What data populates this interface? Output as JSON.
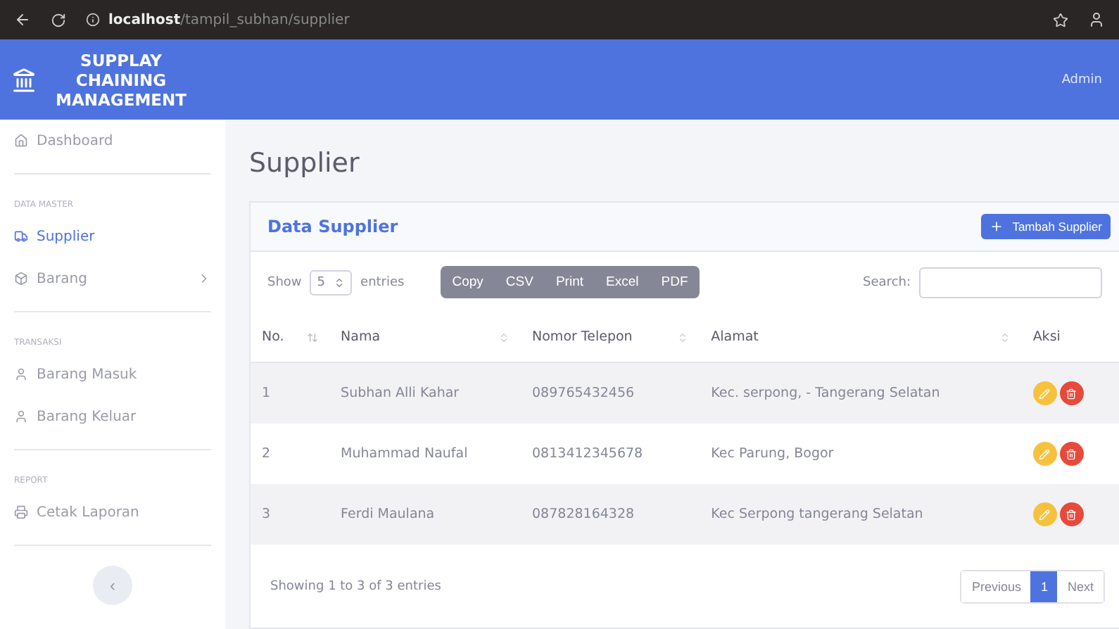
{
  "browser": {
    "url_host": "localhost",
    "url_path": "/tampil_subhan/supplier"
  },
  "header": {
    "brand": "SUPPLAY CHAINING MANAGEMENT",
    "user": "Admin"
  },
  "sidebar": {
    "items": [
      {
        "kind": "link",
        "label": "Dashboard",
        "selected": false
      },
      {
        "kind": "divider"
      },
      {
        "kind": "heading",
        "label": "DATA MASTER"
      },
      {
        "kind": "link",
        "label": "Supplier",
        "selected": true
      },
      {
        "kind": "link",
        "label": "Barang",
        "selected": false,
        "has_submenu": true
      },
      {
        "kind": "divider"
      },
      {
        "kind": "heading",
        "label": "TRANSAKSI"
      },
      {
        "kind": "link",
        "label": "Barang Masuk",
        "selected": false
      },
      {
        "kind": "link",
        "label": "Barang Keluar",
        "selected": false
      },
      {
        "kind": "divider"
      },
      {
        "kind": "heading",
        "label": "REPORT"
      },
      {
        "kind": "link",
        "label": "Cetak Laporan",
        "selected": false
      },
      {
        "kind": "divider"
      }
    ],
    "toggle_label": "‹"
  },
  "page_title": "Supplier",
  "card": {
    "title": "Data Supplier",
    "add_button": "Tambah Supplier",
    "length": {
      "prefix": "Show",
      "value": "5",
      "suffix": "entries"
    },
    "export_buttons": [
      "Copy",
      "CSV",
      "Print",
      "Excel",
      "PDF"
    ],
    "search_label": "Search:",
    "table": {
      "columns": [
        "No.",
        "Nama",
        "Nomor Telepon",
        "Alamat",
        "Aksi"
      ],
      "rows": [
        [
          "1",
          "Subhan Alli Kahar",
          "089765432456",
          "Kec. serpong, - Tangerang Selatan"
        ],
        [
          "2",
          "Muhammad Naufal",
          "0813412345678",
          "Kec Parung, Bogor"
        ],
        [
          "3",
          "Ferdi Maulana",
          "087828164328",
          "Kec Serpong tangerang Selatan"
        ]
      ]
    },
    "info": "Showing 1 to 3 of 3 entries",
    "pagination": [
      {
        "label": "Previous",
        "selected": false
      },
      {
        "label": "1",
        "selected": true
      },
      {
        "label": "Next",
        "selected": false
      }
    ]
  }
}
